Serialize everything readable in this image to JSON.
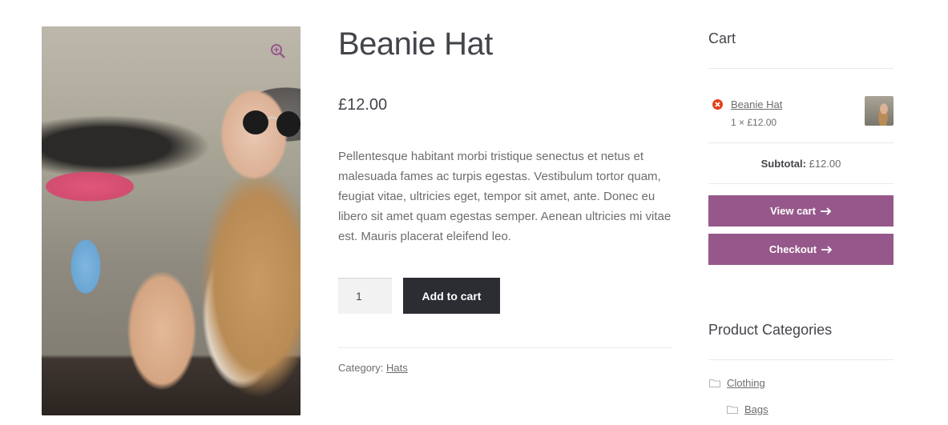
{
  "product": {
    "title": "Beanie Hat",
    "price": "£12.00",
    "description": "Pellentesque habitant morbi tristique senectus et netus et malesuada fames ac turpis egestas. Vestibulum tortor quam, feugiat vitae, ultricies eget, tempor sit amet, ante. Donec eu libero sit amet quam egestas semper. Aenean ultricies mi vitae est. Mauris placerat eleifend leo.",
    "quantity": "1",
    "add_to_cart_label": "Add to cart",
    "category_label": "Category:",
    "category_link": "Hats",
    "image_icon": "zoom-icon"
  },
  "cart": {
    "title": "Cart",
    "item_name": "Beanie Hat",
    "item_qty": "1 × £12.00",
    "subtotal_label": "Subtotal:",
    "subtotal_value": "£12.00",
    "view_cart_label": "View cart",
    "checkout_label": "Checkout"
  },
  "categories": {
    "title": "Product Categories",
    "items": [
      "Clothing",
      "Bags"
    ]
  },
  "colors": {
    "accent": "#96588a",
    "button_dark": "#2c2d33",
    "remove": "#e2401c"
  }
}
